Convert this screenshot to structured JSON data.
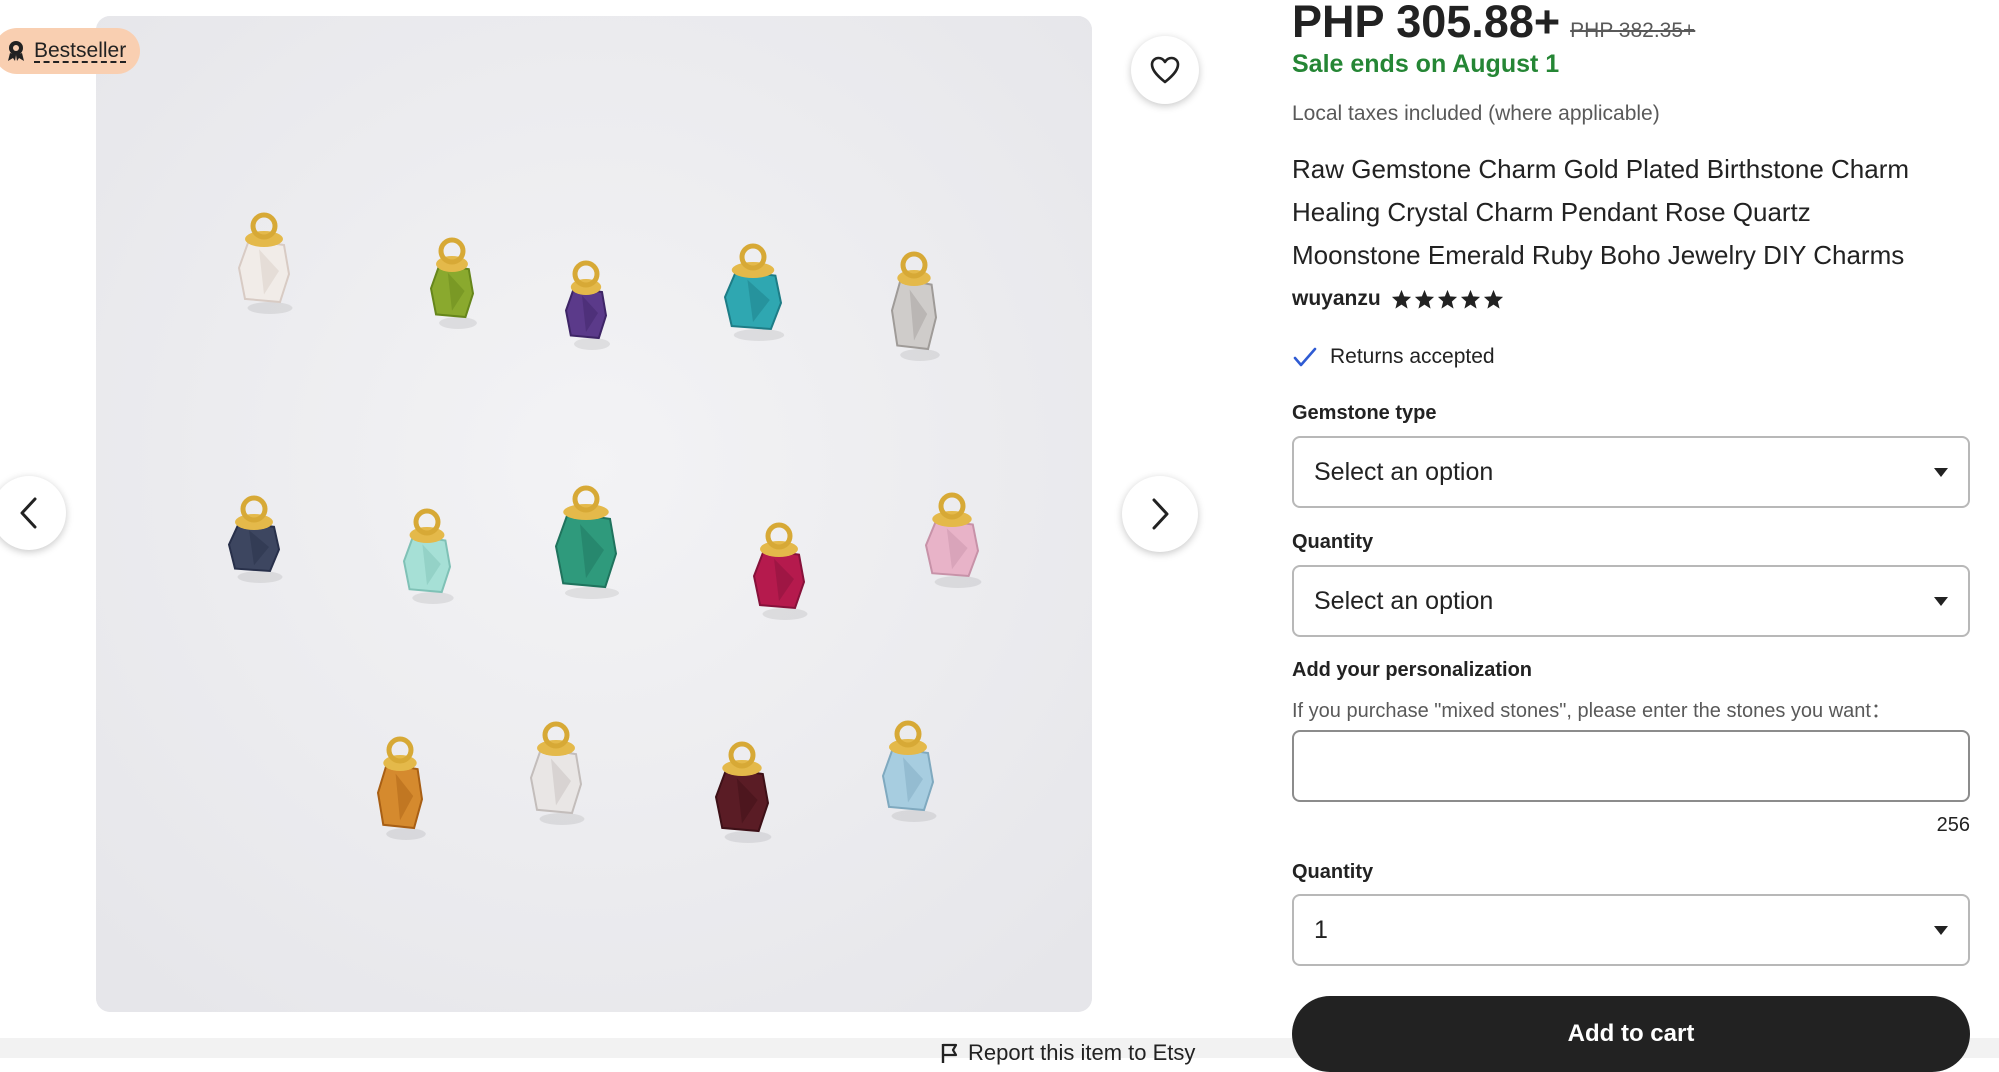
{
  "badge": {
    "label": "Bestseller",
    "icon": "award-ribbon-icon",
    "color": "#f9cfb1"
  },
  "product": {
    "price": "PHP 305.88+",
    "old_price": "PHP 382.35+",
    "sale_text": "Sale ends on August 1",
    "tax_note": "Local taxes included (where applicable)",
    "title_lines": [
      "Raw Gemstone Charm Gold Plated Birthstone Charm",
      "Healing Crystal Charm Pendant Rose Quartz",
      "Moonstone Emerald Ruby Boho Jewelry DIY Charms"
    ],
    "shop": "wuyanzu",
    "rating_stars": 5,
    "returns": "Returns accepted"
  },
  "form": {
    "gemstone_label": "Gemstone type",
    "gemstone_value": "Select an option",
    "quantity_label": "Quantity",
    "quantity_value": "Select an option",
    "personalization_label": "Add your personalization",
    "personalization_hint": "If you purchase \"mixed stones\", please enter the stones you want：",
    "personalization_value": "",
    "char_count": "256",
    "quantity2_label": "Quantity",
    "quantity2_value": "1",
    "add_to_cart": "Add to cart"
  },
  "footer": {
    "report_text": "Report this item to Etsy"
  },
  "colors": {
    "sale_green": "#258635",
    "button_dark": "#222222",
    "accent_blue": "#2f5bd3"
  }
}
